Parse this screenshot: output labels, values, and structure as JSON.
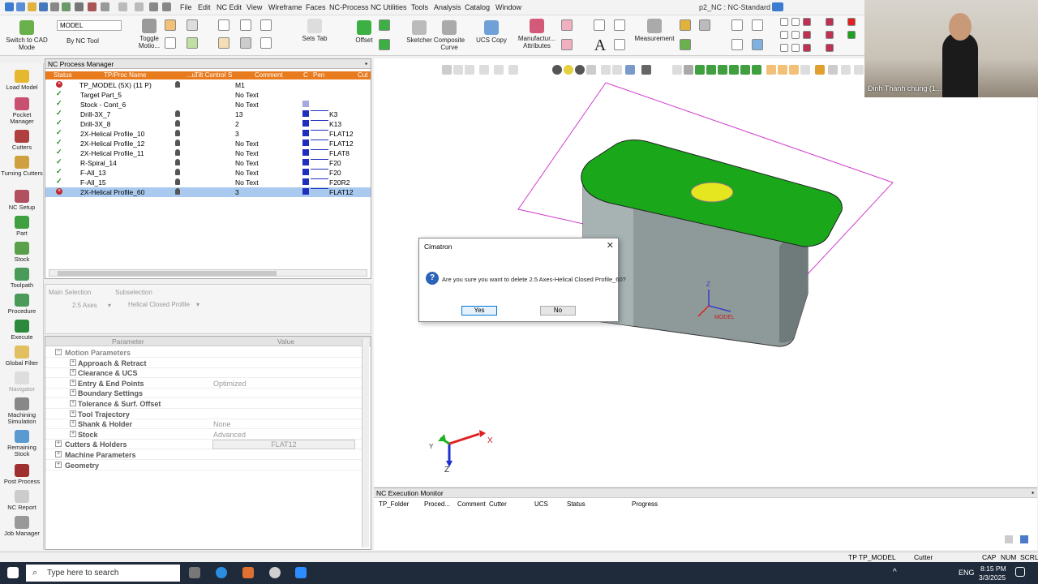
{
  "menu": {
    "items": [
      "File",
      "Edit",
      "NC Edit",
      "View",
      "Wireframe",
      "Faces",
      "NC-Process",
      "NC Utilities",
      "Tools",
      "Analysis",
      "Catalog",
      "Window"
    ],
    "title": "p2_NC : NC-Standard"
  },
  "ribbon": {
    "switch_cad": "Switch to CAD Mode",
    "model_select": "MODEL",
    "by_nc_tool": "By NC Tool",
    "toggle_motion": "Toggle Motio...",
    "sets_tab": "Sets Tab",
    "offset": "Offset",
    "sketcher": "Sketcher",
    "composite_curve": "Composite Curve",
    "ucs_copy": "UCS Copy",
    "manufacturing_attributes": "Manufactur... Attributes",
    "measurement": "Measurement"
  },
  "sidebar": [
    {
      "label": "Load Model"
    },
    {
      "label": "Pocket Manager"
    },
    {
      "label": "Cutters"
    },
    {
      "label": "Turning Cutters"
    },
    {
      "label": "NC Setup"
    },
    {
      "label": "Part"
    },
    {
      "label": "Stock"
    },
    {
      "label": "Toolpath"
    },
    {
      "label": "Procedure"
    },
    {
      "label": "Execute"
    },
    {
      "label": "Global Filter"
    },
    {
      "label": "Navigator"
    },
    {
      "label": "Machining Simulation"
    },
    {
      "label": "Remaining Stock"
    },
    {
      "label": "Post Process"
    },
    {
      "label": "NC Report"
    },
    {
      "label": "Job Manager"
    }
  ],
  "process_manager": {
    "title": "NC Process Manager",
    "headers": [
      "Status",
      "TP/Proc Name",
      "...u",
      "Tilt Control",
      "S",
      "Comment",
      "C",
      "Pen",
      "Cut"
    ],
    "rows": [
      {
        "status": "x",
        "name": "TP_MODEL (5X) (11 P)",
        "comment": "M1",
        "pen": ""
      },
      {
        "status": "ok",
        "name": "Target Part_5",
        "comment": "No Text",
        "pen": ""
      },
      {
        "status": "ok",
        "name": "Stock - Cont_6",
        "comment": "No Text",
        "pen": ""
      },
      {
        "status": "ok",
        "name": "Drill-3X_7",
        "comment": "13",
        "pen": "K3"
      },
      {
        "status": "ok",
        "name": "Drill-3X_8",
        "comment": "2",
        "pen": "K13"
      },
      {
        "status": "ok",
        "name": "2X-Helical Profile_10",
        "comment": "3",
        "pen": "FLAT12"
      },
      {
        "status": "ok",
        "name": "2X-Helical Profile_12",
        "comment": "No Text",
        "pen": "FLAT12"
      },
      {
        "status": "ok",
        "name": "2X-Helical Profile_11",
        "comment": "No Text",
        "pen": "FLAT8"
      },
      {
        "status": "ok",
        "name": "R-Spiral_14",
        "comment": "No Text",
        "pen": "F20"
      },
      {
        "status": "ok",
        "name": "F-All_13",
        "comment": "No Text",
        "pen": "F20"
      },
      {
        "status": "ok",
        "name": "F-All_15",
        "comment": "No Text",
        "pen": "F20R2"
      },
      {
        "status": "x",
        "name": "2X-Helical Profile_60",
        "comment": "3",
        "pen": "FLAT12"
      }
    ]
  },
  "selection": {
    "main_label": "Main Selection",
    "sub_label": "Subselection",
    "main_value": "2.5 Axes",
    "sub_value": "Helical Closed Profile"
  },
  "parameters": {
    "head_param": "Parameter",
    "head_value": "Value",
    "rows": [
      {
        "name": "Motion Parameters",
        "value": ""
      },
      {
        "name": "Approach & Retract",
        "value": ""
      },
      {
        "name": "Clearance & UCS",
        "value": ""
      },
      {
        "name": "Entry & End Points",
        "value": "Optimized"
      },
      {
        "name": "Boundary Settings",
        "value": ""
      },
      {
        "name": "Tolerance & Surf. Offset",
        "value": ""
      },
      {
        "name": "Tool Trajectory",
        "value": ""
      },
      {
        "name": "Shank & Holder",
        "value": "None"
      },
      {
        "name": "Stock",
        "value": "Advanced"
      },
      {
        "name": "Cutters & Holders",
        "value": "FLAT12"
      },
      {
        "name": "Machine Parameters",
        "value": ""
      },
      {
        "name": "Geometry",
        "value": ""
      }
    ]
  },
  "dialog": {
    "title": "Cimatron",
    "close": "✕",
    "message": "Are you sure you want to delete 2.5 Axes-Helical Closed Profile_60?",
    "yes": "Yes",
    "no": "No"
  },
  "viewport": {
    "axis_x": "X",
    "axis_y": "Y",
    "axis_z": "Z",
    "ucs_label": "MODEL",
    "part_color": "#1aa81a",
    "frame_color": "#d040d0"
  },
  "monitor": {
    "title": "NC Execution Monitor",
    "headers": [
      "TP_Folder",
      "Proced...",
      "Comment",
      "Cutter",
      "UCS",
      "Status",
      "Progress"
    ]
  },
  "statusbar": {
    "tp": "TP  TP_MODEL",
    "cutter": "Cutter",
    "cap": "CAP",
    "num": "NUM",
    "scrl": "SCRL"
  },
  "taskbar": {
    "search_placeholder": "Type here to search",
    "lang": "ENG",
    "time": "8:15 PM",
    "date": "3/3/2025"
  },
  "webcam": {
    "name": "Đinh Thành chung (1..."
  }
}
